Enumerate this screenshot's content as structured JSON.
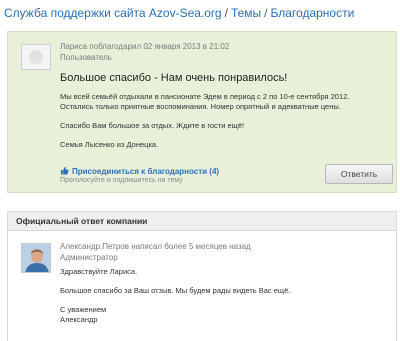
{
  "breadcrumb": {
    "site": "Служба поддержки сайта Azov-Sea.org",
    "sep1": "/",
    "topics": "Темы",
    "sep2": "/",
    "current": "Благодарности"
  },
  "topic": {
    "meta": "Лариса поблагодарил 02 января 2013 в 21:02",
    "role": "Пользователь",
    "title": "Большое спасибо - Нам очень понравилось!",
    "paragraphs": [
      "Мы всей семьёй отдыхали в пансионате Эдем в период с 2 по 10-е сентября 2012. Остались только приятные воспоминания. Номер опрятный и адекватные цены.",
      "Спасибо Вам большое за отдых. Ждите в гости ещё!",
      "Семья Лысенко из Донецка."
    ],
    "join_label": "Присоединиться к благодарности (4)",
    "join_sub": "Проголосуйте и подпишитесь на тему",
    "reply_label": "Ответить"
  },
  "official": {
    "header": "Официальный ответ компании",
    "meta": "Александр.Петров написал более 5 месяцев назад",
    "role": "Администратор",
    "paragraphs": [
      "Здравствуйте Лариса.",
      "Большое спасибо за Ваш отзыв. Мы будем рады видеть Вас ещё.",
      "С уважением",
      "Александр"
    ]
  },
  "colors": {
    "link": "#2b6fb6",
    "topic_bg": "#e8f0d9"
  }
}
